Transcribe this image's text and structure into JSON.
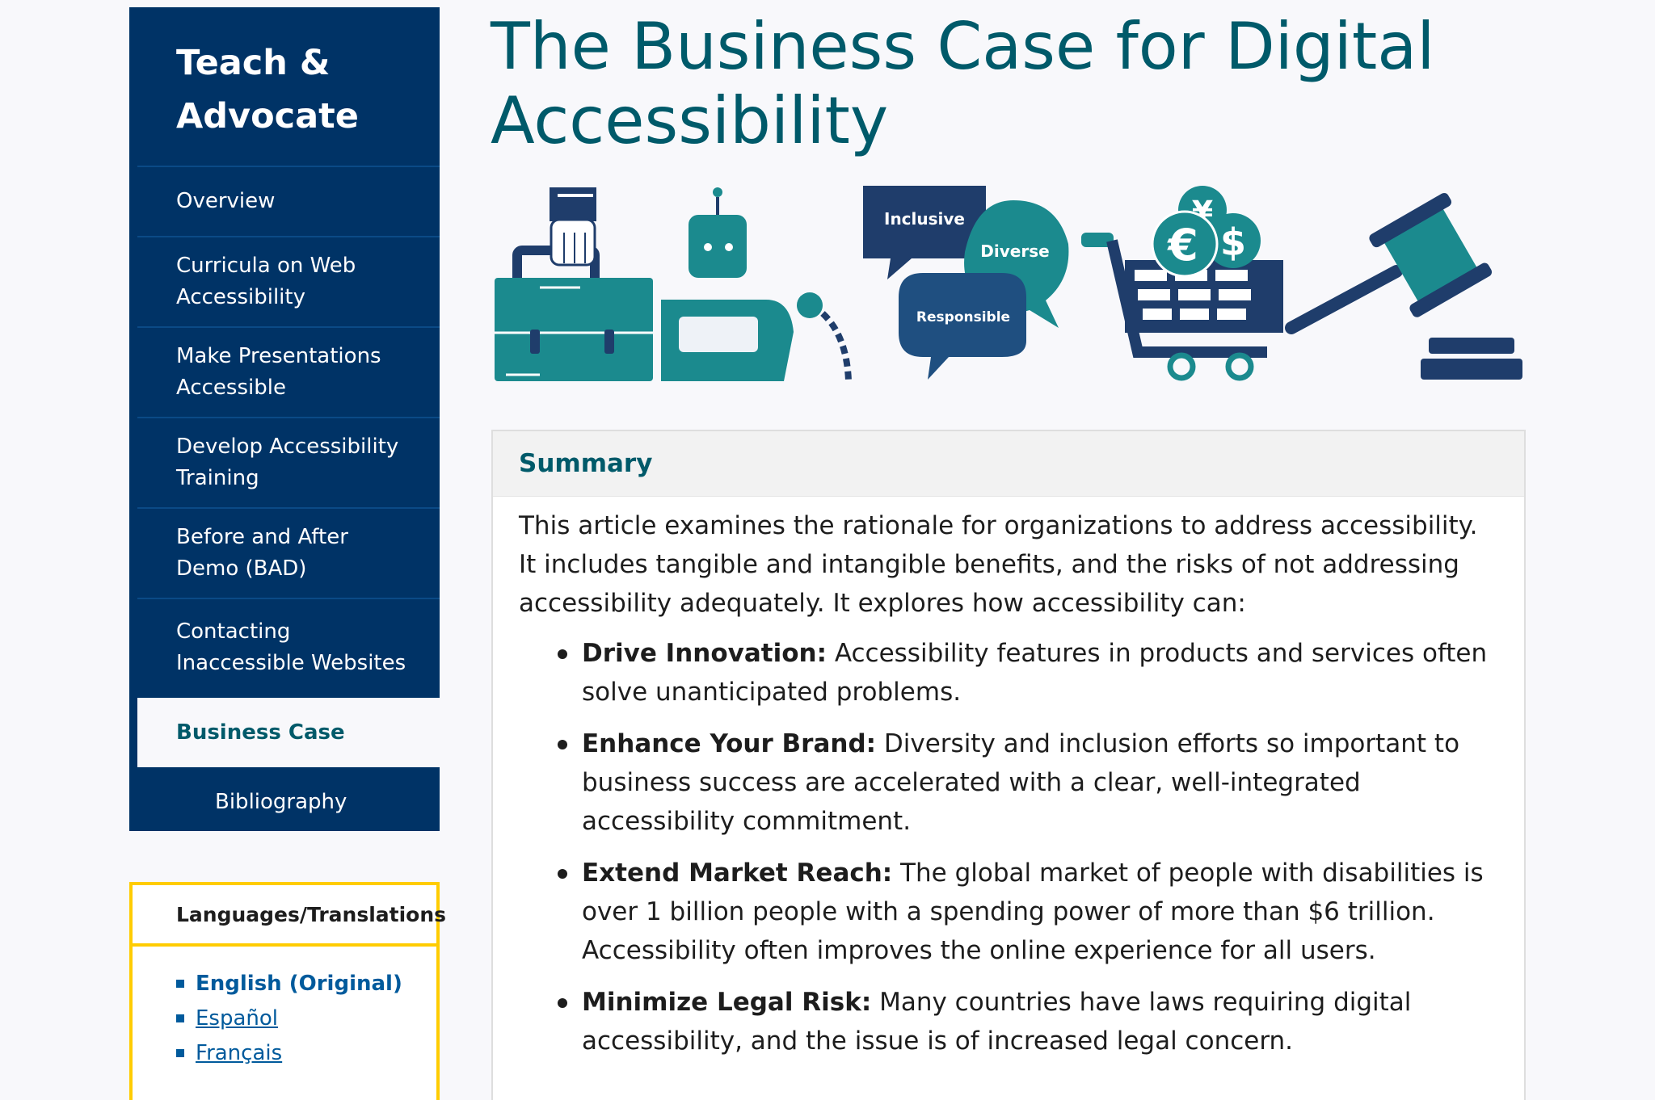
{
  "sidebar": {
    "title": "Teach & Advocate",
    "items": [
      {
        "label": "Overview"
      },
      {
        "label": "Curricula on Web Accessibility"
      },
      {
        "label": "Make Presentations Accessible"
      },
      {
        "label": "Develop Accessibility Training"
      },
      {
        "label": "Before and After Demo (BAD)"
      },
      {
        "label": "Contacting Inaccessible Websites"
      },
      {
        "label": "Business Case",
        "active": true
      },
      {
        "label": "Bibliography",
        "sub": true
      }
    ]
  },
  "languages": {
    "title": "Languages/Translations",
    "items": [
      {
        "label": "English (Original)",
        "current": true
      },
      {
        "label": "Español"
      },
      {
        "label": "Français"
      }
    ]
  },
  "page": {
    "title": "The Business Case for Digital Accessibility"
  },
  "hero": {
    "bubbles": [
      "Inclusive",
      "Diverse",
      "Responsible"
    ]
  },
  "summary": {
    "heading": "Summary",
    "intro": "This article examines the rationale for organizations to address accessibility. It includes tangible and intangible benefits, and the risks of not addressing accessibility adequately. It explores how accessibility can:",
    "benefits": [
      {
        "term": "Drive Innovation:",
        "text": " Accessibility features in products and services often solve unanticipated problems."
      },
      {
        "term": "Enhance Your Brand:",
        "text": " Diversity and inclusion efforts so important to business success are accelerated with a clear, well-integrated accessibility commitment."
      },
      {
        "term": "Extend Market Reach:",
        "text": " The global market of people with disabilities is over 1 billion people with a spending power of more than $6 trillion. Accessibility often improves the online experience for all users."
      },
      {
        "term": "Minimize Legal Risk:",
        "text": " Many countries have laws requiring digital accessibility, and the issue is of increased legal concern."
      }
    ]
  },
  "colors": {
    "navy": "#003366",
    "teal": "#005a6a",
    "illustration_teal": "#1b8a8e",
    "illustration_navy": "#1f3d6b",
    "highlight": "#ffcc00",
    "link": "#005a9c"
  },
  "icons": [
    "briefcase-icon",
    "robot-icon",
    "speech-bubbles-icon",
    "shopping-cart-icon",
    "currency-coins-icon",
    "gavel-icon"
  ]
}
